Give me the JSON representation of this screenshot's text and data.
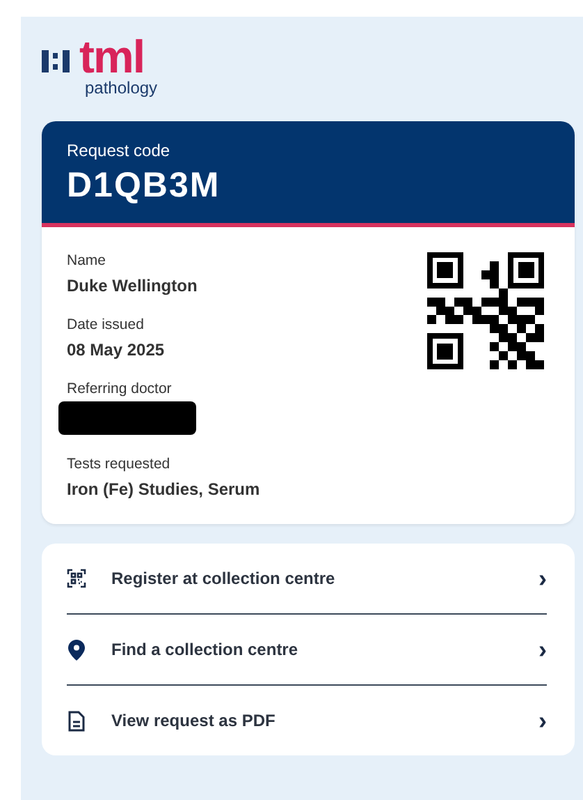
{
  "logo": {
    "wordmark": "tml",
    "subtitle": "pathology"
  },
  "request": {
    "label": "Request code",
    "code": "D1QB3M"
  },
  "details": [
    {
      "label": "Name",
      "value": "Duke Wellington",
      "redacted": false
    },
    {
      "label": "Date issued",
      "value": "08 May 2025",
      "redacted": false
    },
    {
      "label": "Referring doctor",
      "redacted": true
    },
    {
      "label": "Tests requested",
      "value": "Iron (Fe) Studies, Serum",
      "redacted": false
    }
  ],
  "actions": [
    {
      "kind": "qr",
      "label": "Register at collection centre",
      "chevron": "›"
    },
    {
      "kind": "pin",
      "label": "Find a collection centre",
      "chevron": "›"
    },
    {
      "kind": "document",
      "label": "View request as PDF",
      "chevron": "›"
    }
  ]
}
